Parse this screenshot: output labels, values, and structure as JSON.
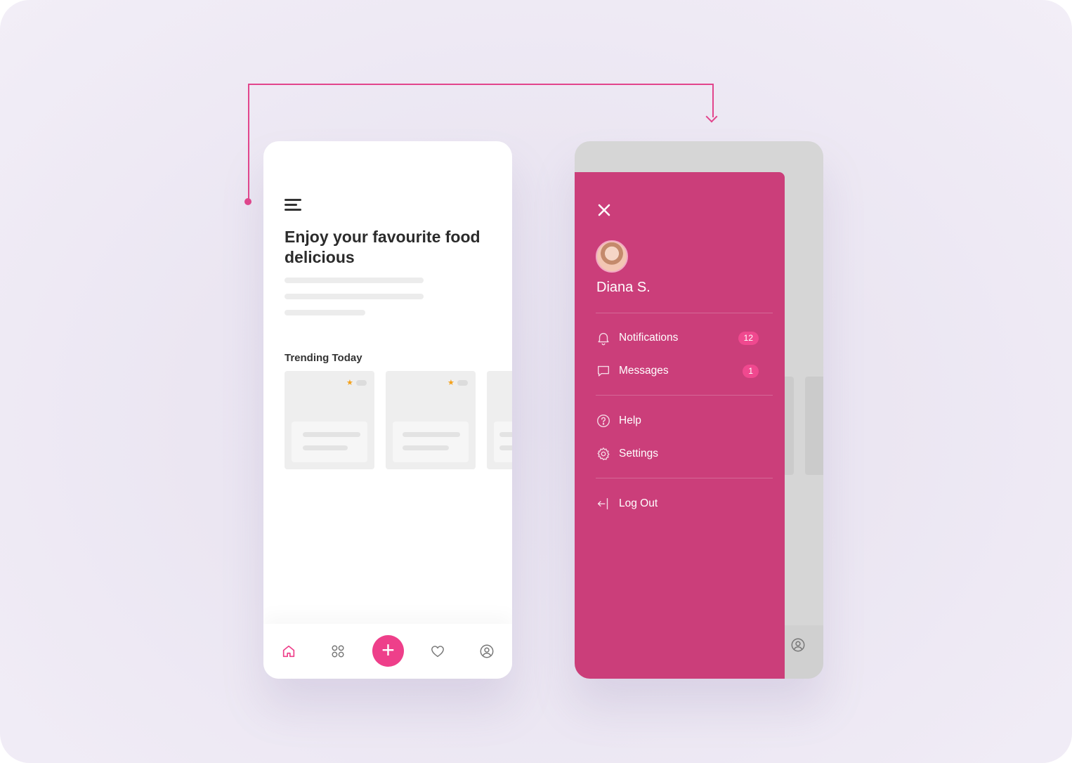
{
  "home": {
    "headline": "Enjoy your favourite food delicious",
    "section_title": "Trending Today",
    "cards": [
      {
        "rating_icon": "star-icon"
      },
      {
        "rating_icon": "star-icon"
      },
      {
        "rating_icon": "star-icon"
      }
    ],
    "tabs": [
      {
        "icon": "home-icon",
        "active": true
      },
      {
        "icon": "grid-icon",
        "active": false
      },
      {
        "icon": "plus-icon",
        "active": false
      },
      {
        "icon": "heart-icon",
        "active": false
      },
      {
        "icon": "profile-icon",
        "active": false
      }
    ],
    "fab_label": "+"
  },
  "drawer": {
    "user_name": "Diana S.",
    "items": [
      {
        "label": "Notifications",
        "icon": "bell-icon",
        "badge": "12"
      },
      {
        "label": "Messages",
        "icon": "chat-icon",
        "badge": "1"
      },
      {
        "label": "Help",
        "icon": "help-icon"
      },
      {
        "label": "Settings",
        "icon": "gear-icon"
      },
      {
        "label": "Log Out",
        "icon": "logout-icon"
      }
    ]
  },
  "colors": {
    "accent": "#ee3f8a",
    "drawer_bg": "#cb3e7a",
    "badge": "#f0498f",
    "star": "#f4a11a",
    "canvas": "#ebe6f2"
  }
}
